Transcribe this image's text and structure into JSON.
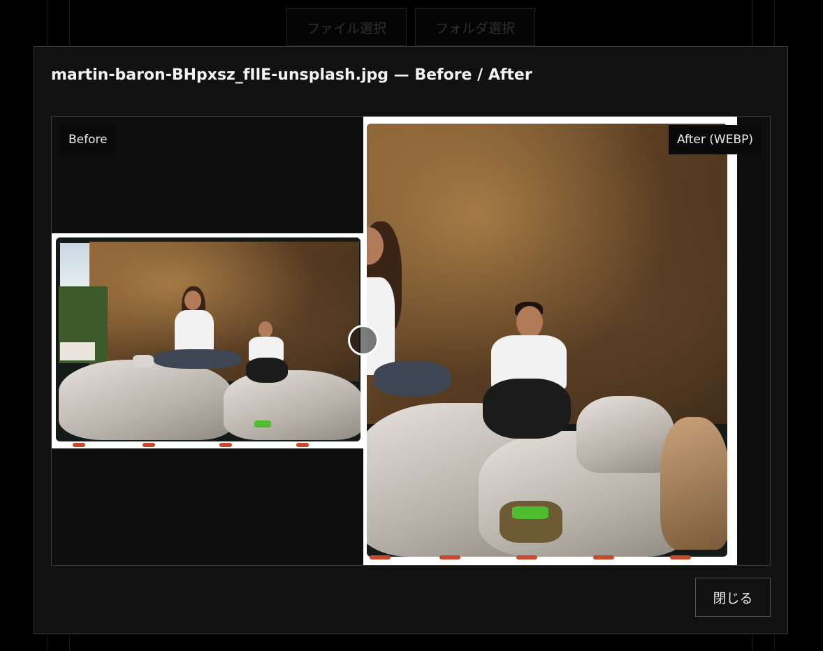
{
  "background": {
    "file_select_label": "ファイル選択",
    "folder_select_label": "フォルダ選択"
  },
  "modal": {
    "title": "martin-baron-BHpxsz_fIlE-unsplash.jpg — Before / After",
    "before_label": "Before",
    "after_label": "After (WEBP)",
    "close_label": "閉じる",
    "slider_position": 0.435
  },
  "colors": {
    "modal_bg": "#111111",
    "page_bg": "#000000",
    "border": "#3c3c3c",
    "text": "#f2f2f2"
  }
}
